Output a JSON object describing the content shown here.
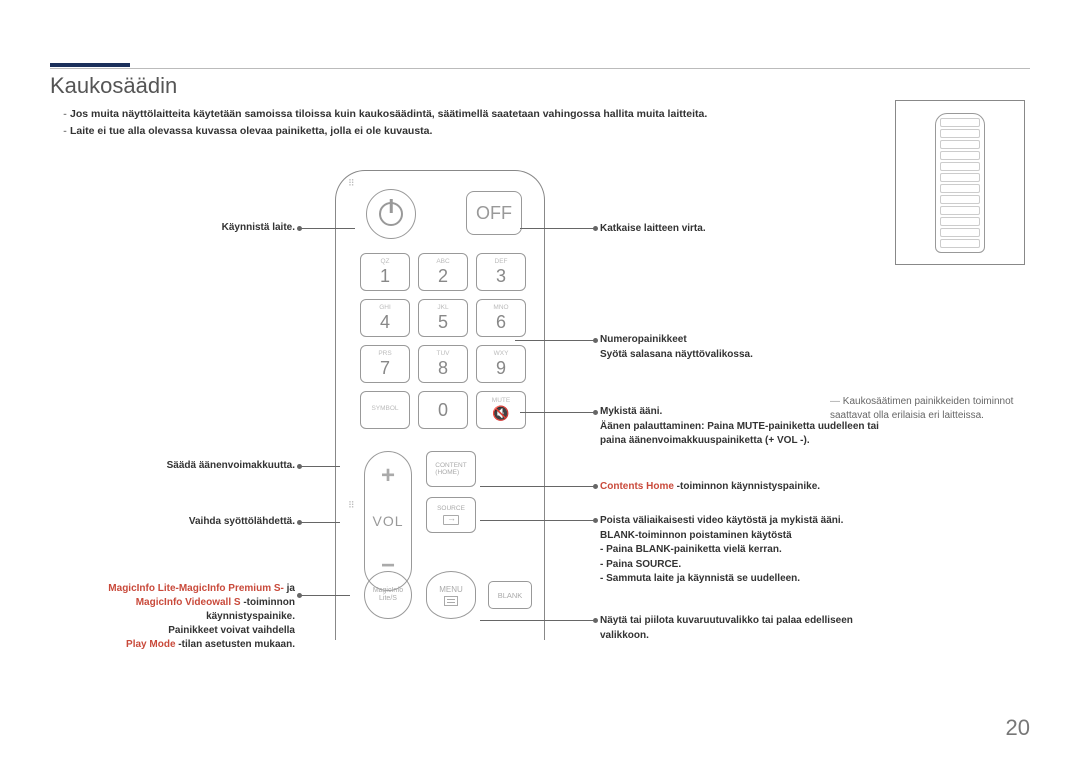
{
  "title": "Kaukosäädin",
  "notes": [
    "Jos muita näyttölaitteita käytetään samoissa tiloissa kuin kaukosäädintä, säätimellä saatetaan vahingossa hallita muita laitteita.",
    "Laite ei tue alla olevassa kuvassa olevaa painiketta, jolla ei ole kuvausta."
  ],
  "left_callouts": {
    "power": "Käynnistä laite.",
    "vol": "Säädä äänenvoimakkuutta.",
    "source": "Vaihda syöttölähdettä.",
    "magic_line1_red": "MagicInfo Lite-MagicInfo Premium S-",
    "magic_line1_tail": " ja",
    "magic_line2_red": "MagicInfo Videowall S",
    "magic_line2_tail": " -toiminnon käynnistyspainike.",
    "magic_line3": "Painikkeet voivat vaihdella",
    "magic_line4_red": "Play Mode",
    "magic_line4_tail": " -tilan asetusten mukaan."
  },
  "right_callouts": {
    "off": "Katkaise laitteen virta.",
    "numpad_title": "Numeropainikkeet",
    "numpad_sub": "Syötä salasana näyttövalikossa.",
    "mute_title": "Mykistä ääni.",
    "mute_sub": "Äänen palauttaminen: Paina MUTE-painiketta uudelleen tai paina äänenvoimakkuuspainiketta (+ VOL -).",
    "content_red": "Contents Home",
    "content_tail": " -toiminnon käynnistyspainike.",
    "blank_l1": "Poista väliaikaisesti video käytöstä ja mykistä ääni.",
    "blank_l2": "BLANK-toiminnon poistaminen käytöstä",
    "blank_l3": "- Paina BLANK-painiketta vielä kerran.",
    "blank_l4": "- Paina SOURCE.",
    "blank_l5": "- Sammuta laite ja käynnistä se uudelleen.",
    "menu": "Näytä tai piilota kuvaruutuvalikko tai palaa edelliseen valikkoon."
  },
  "remote": {
    "off": "OFF",
    "vol": "VOL",
    "keys": {
      "1": {
        "l": "QZ",
        "n": "1"
      },
      "2": {
        "l": "ABC",
        "n": "2"
      },
      "3": {
        "l": "DEF",
        "n": "3"
      },
      "4": {
        "l": "GHI",
        "n": "4"
      },
      "5": {
        "l": "JKL",
        "n": "5"
      },
      "6": {
        "l": "MNO",
        "n": "6"
      },
      "7": {
        "l": "PRS",
        "n": "7"
      },
      "8": {
        "l": "TUV",
        "n": "8"
      },
      "9": {
        "l": "WXY",
        "n": "9"
      },
      "sym": {
        "l": "SYMBOL",
        "n": ""
      },
      "0": {
        "l": "",
        "n": "0"
      },
      "mute": {
        "l": "MUTE",
        "n": ""
      }
    },
    "content": "CONTENT\n(HOME)",
    "source": "SOURCE",
    "magic": "MagicInfo\nLite/S",
    "menu": "MENU",
    "blank": "BLANK"
  },
  "side_note": "Kaukosäätimen painikkeiden toiminnot saattavat olla erilaisia eri laitteissa.",
  "page_number": "20"
}
